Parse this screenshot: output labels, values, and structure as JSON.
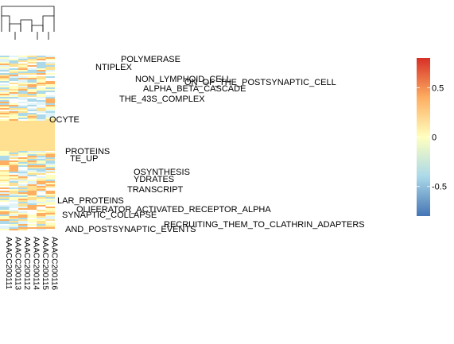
{
  "chart_data": {
    "type": "heatmap",
    "title": "",
    "xlabel": "",
    "ylabel": "",
    "row_labels_legible": [
      "POLYMERASE",
      "NTIPLEX",
      "NON_LYMPHOID_CELL",
      "ON_OF_THE_POSTSYNAPTIC_CELL",
      "ALPHA_BETA_CASCADE",
      "THE_43S_COMPLEX",
      "OCYTE",
      "PROTEINS",
      "TE_UP",
      "OSYNTHESIS",
      "YDRATES",
      "TRANSCRIPT",
      "LAR_PROTEINS",
      "OLIFERATOR_ACTIVATED_RECEPTOR_ALPHA",
      "SYNAPTIC_COLLAPSE",
      "RECRUITING_THEM_TO_CLATHRIN_ADAPTERS",
      "AND_POSTSYNAPTIC_EVENTS"
    ],
    "column_labels": [
      "AAACC200111",
      "AAACC200113",
      "AAACC200112",
      "AAACC200114",
      "AAACC200115",
      "AAACC200116"
    ],
    "color_scale": {
      "low": "#4575B4",
      "mid": "#FFFFBF",
      "high": "#D73027",
      "min": -0.8,
      "max": 0.8
    },
    "legend_ticks": [
      "0.5",
      "0",
      "-0.5"
    ],
    "legend_tick_values": [
      0.5,
      0,
      -0.5
    ]
  }
}
